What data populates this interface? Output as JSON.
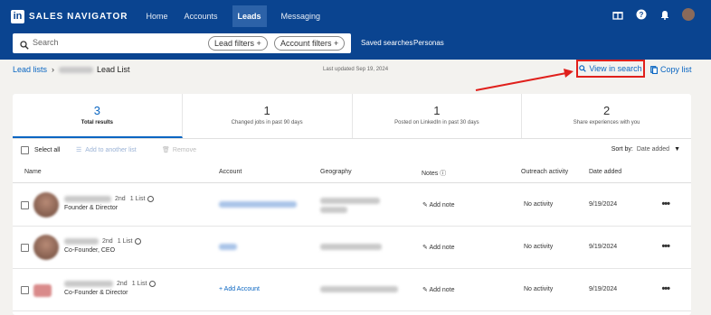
{
  "header": {
    "logo": "in",
    "brand": "SALES NAVIGATOR",
    "nav": [
      {
        "label": "Home",
        "active": false
      },
      {
        "label": "Accounts",
        "active": false
      },
      {
        "label": "Leads",
        "active": true
      },
      {
        "label": "Messaging",
        "active": false
      }
    ],
    "icons": [
      "gift-icon",
      "help-icon",
      "bell-icon",
      "avatar"
    ]
  },
  "search": {
    "placeholder": "Search",
    "lead_filters": "Lead filters",
    "account_filters": "Account filters",
    "saved_searches": "Saved searches",
    "personas": "Personas"
  },
  "breadcrumb": {
    "lead_lists": "Lead lists",
    "separator": "›",
    "list_name": "Lead List"
  },
  "last_updated": "Last updated Sep 19, 2024",
  "actions": {
    "view_in_search": "View in search",
    "copy_list": "Copy list"
  },
  "stats": [
    {
      "value": "3",
      "label": "Total results",
      "active": true
    },
    {
      "value": "1",
      "label": "Changed jobs in past 90 days",
      "active": false
    },
    {
      "value": "1",
      "label": "Posted on LinkedIn in past 30 days",
      "active": false
    },
    {
      "value": "2",
      "label": "Share experiences with you",
      "active": false
    }
  ],
  "toolbar": {
    "select_all": "Select all",
    "add_to_list": "Add to another list",
    "remove": "Remove",
    "sort_by": "Sort by:",
    "sort_value": "Date added"
  },
  "columns": [
    "Name",
    "Account",
    "Geography",
    "Notes",
    "Outreach activity",
    "Date added"
  ],
  "rows": [
    {
      "degree": "2nd",
      "lists": "1 List",
      "title": "Founder & Director",
      "account": "",
      "add_note": "Add note",
      "outreach": "No activity",
      "date": "9/19/2024"
    },
    {
      "degree": "2nd",
      "lists": "1 List",
      "title": "Co-Founder, CEO",
      "account": "",
      "add_note": "Add note",
      "outreach": "No activity",
      "date": "9/19/2024"
    },
    {
      "degree": "2nd",
      "lists": "1 List",
      "title": "Co-Founder & Director",
      "account": "Add Account",
      "add_note": "Add note",
      "outreach": "No activity",
      "date": "9/19/2024"
    }
  ],
  "colors": {
    "header_bg": "#0a4490",
    "link": "#0a66c2",
    "highlight": "#e0201c"
  }
}
